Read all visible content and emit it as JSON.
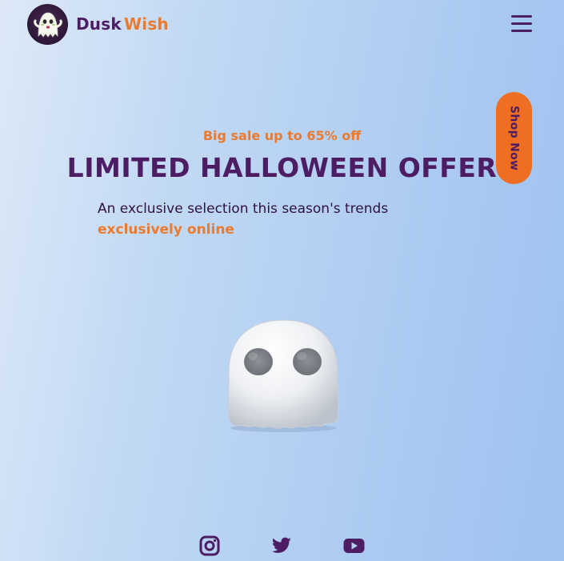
{
  "header": {
    "logo_icon": "ghost-logo-icon",
    "brand_first": "Dusk",
    "brand_second": "Wish",
    "menu_icon": "hamburger-menu-icon"
  },
  "cta": {
    "shop_now_label": "Shop Now"
  },
  "hero": {
    "eyebrow": "Big sale up to 65% off",
    "headline": "LIMITED HALLOWEEN OFFER",
    "subline_text": "An exclusive selection this season's trends ",
    "subline_highlight": "exclusively online",
    "illustration": "ghost-illustration"
  },
  "social": {
    "items": [
      {
        "name": "instagram",
        "icon": "instagram-icon"
      },
      {
        "name": "twitter",
        "icon": "twitter-icon"
      },
      {
        "name": "youtube",
        "icon": "youtube-icon"
      }
    ]
  },
  "colors": {
    "primary_purple": "#4c1d62",
    "accent_orange": "#ea7a2e",
    "button_orange": "#ef6e22",
    "background_light": "#dde9f7",
    "background_blue": "#9fc2ef"
  }
}
